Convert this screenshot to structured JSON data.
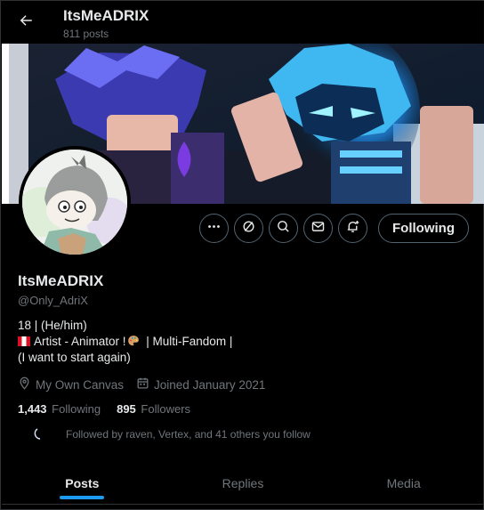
{
  "header": {
    "title": "ItsMeADRIX",
    "post_count": "811 posts"
  },
  "profile": {
    "display_name": "ItsMeADRIX",
    "handle": "@Only_AdriX",
    "bio_line1": "18 | (He/him)",
    "bio_line2_a": "Artist - Animator !",
    "bio_line2_b": " | Multi-Fandom |",
    "bio_line3": "(I want to start again)",
    "location": "My Own Canvas",
    "joined": "Joined January 2021",
    "following_count": "1,443",
    "following_label": "Following",
    "followers_count": "895",
    "followers_label": "Followers",
    "followed_by": "Followed by raven, Vertex, and 41 others you follow"
  },
  "actions": {
    "follow_label": "Following",
    "icons": [
      "more-icon",
      "grok-icon",
      "search-icon",
      "message-icon",
      "notifications-icon"
    ]
  },
  "tabs": [
    {
      "label": "Posts",
      "active": true
    },
    {
      "label": "Replies",
      "active": false
    },
    {
      "label": "Media",
      "active": false
    }
  ],
  "colors": {
    "accent": "#1d9bf0",
    "muted": "#71767b",
    "text": "#e7e9ea",
    "background": "#000000"
  }
}
